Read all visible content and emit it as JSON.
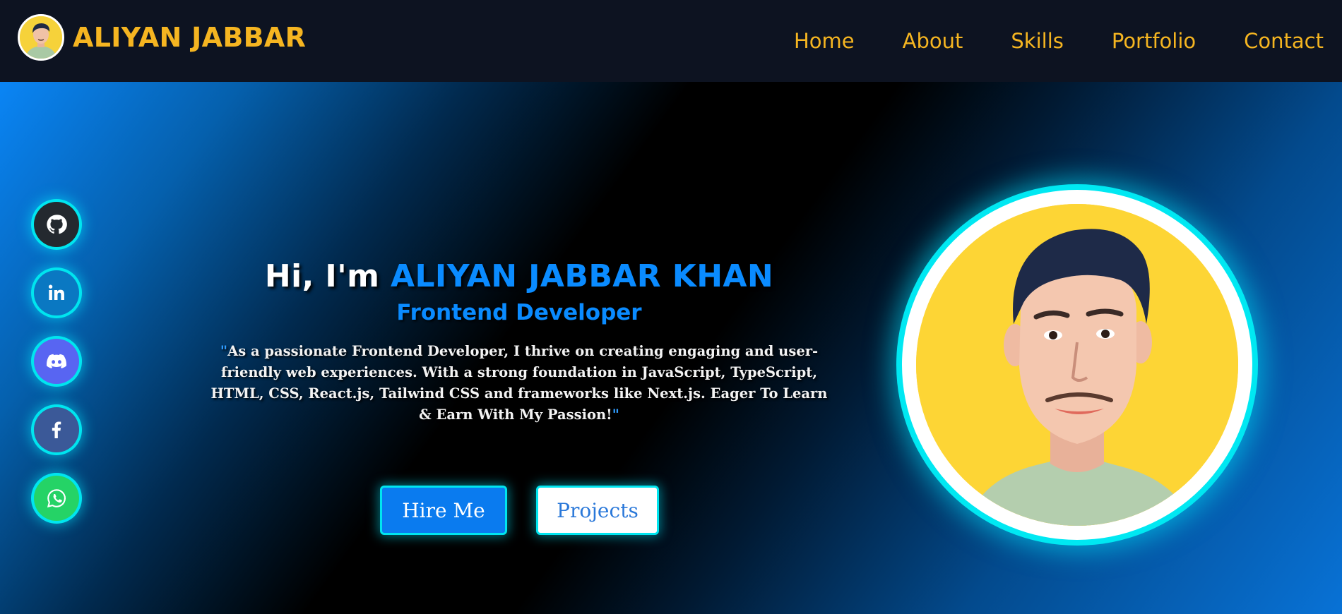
{
  "header": {
    "brand_name": "ALIYAN JABBAR",
    "nav": [
      "Home",
      "About",
      "Skills",
      "Portfolio",
      "Contact"
    ]
  },
  "social": [
    {
      "name": "github",
      "icon": "github-icon",
      "bg": "#24292f"
    },
    {
      "name": "linkedin",
      "icon": "linkedin-icon",
      "bg": "#0a78c2"
    },
    {
      "name": "discord",
      "icon": "discord-icon",
      "bg": "#5865f2"
    },
    {
      "name": "facebook",
      "icon": "facebook-icon",
      "bg": "#3b5998"
    },
    {
      "name": "whatsapp",
      "icon": "whatsapp-icon",
      "bg": "#25d366"
    }
  ],
  "hero": {
    "greeting_prefix": "Hi, I'm",
    "full_name": "ALIYAN JABBAR KHAN",
    "role": "Frontend Developer",
    "quote_open": "\"",
    "bio": "As a passionate Frontend Developer, I thrive on creating engaging and user-friendly web experiences. With a strong foundation in JavaScript, TypeScript, HTML, CSS, React.js, Tailwind CSS and frameworks like Next.js. Eager To Learn & Earn With My Passion!",
    "quote_close": "\"",
    "hire_label": "Hire Me",
    "projects_label": "Projects"
  },
  "colors": {
    "accent_gold": "#f5b521",
    "accent_blue": "#0a8bff",
    "glow_cyan": "#00e5ef",
    "header_bg": "#0d1321",
    "portrait_bg": "#fdd535"
  }
}
